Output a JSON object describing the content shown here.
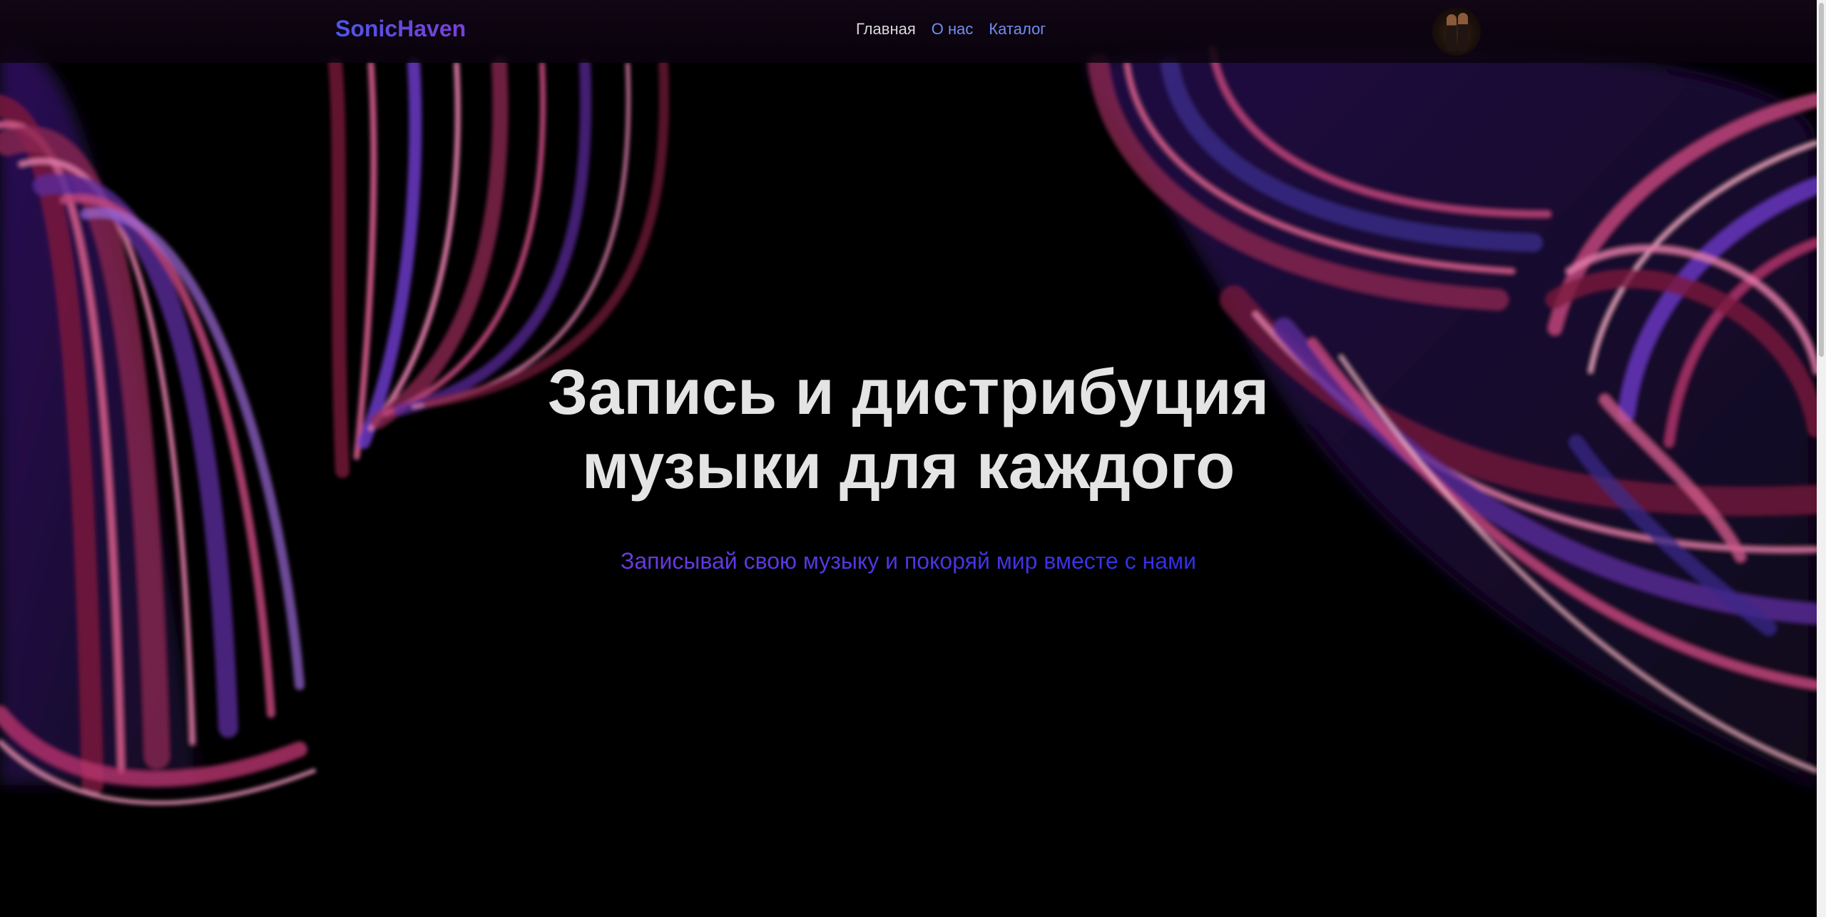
{
  "brand": {
    "name": "SonicHaven"
  },
  "nav": {
    "items": [
      {
        "label": "Главная",
        "active": true
      },
      {
        "label": "О нас",
        "active": false
      },
      {
        "label": "Каталог",
        "active": false
      }
    ]
  },
  "hero": {
    "title_line1": "Запись и дистрибуция",
    "title_line2": "музыки для каждого",
    "subtitle": "Записывай свою музыку и покоряй мир вместе с нами"
  },
  "colors": {
    "background": "#000000",
    "accent_blue": "#4b57e6",
    "accent_purple": "#7a3fd6",
    "nav_link": "#6f8ff0",
    "title_text": "#e4e4e4"
  }
}
